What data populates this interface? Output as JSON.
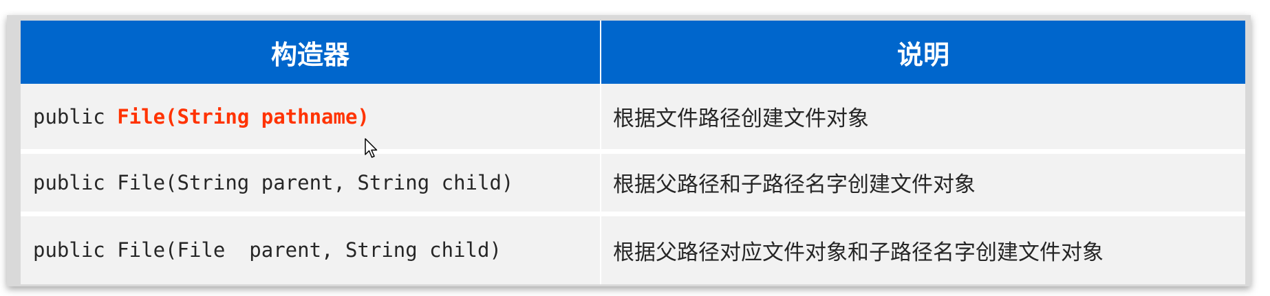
{
  "table": {
    "headers": [
      "构造器",
      "说明"
    ],
    "rows": [
      {
        "prefix": "public ",
        "highlight": "File(String pathname)",
        "highlight_color": "#ff3300",
        "description": "根据文件路径创建文件对象"
      },
      {
        "constructor": "public File(String parent, String child)",
        "description": "根据父路径和子路径名字创建文件对象"
      },
      {
        "constructor": "public File(File  parent, String child)",
        "description": "根据父路径对应文件对象和子路径名字创建文件对象"
      }
    ]
  },
  "colors": {
    "header_bg": "#0066cc",
    "header_text": "#ffffff",
    "row_bg": "#f2f2f2"
  },
  "icons": {
    "cursor": "mouse-pointer-icon"
  }
}
